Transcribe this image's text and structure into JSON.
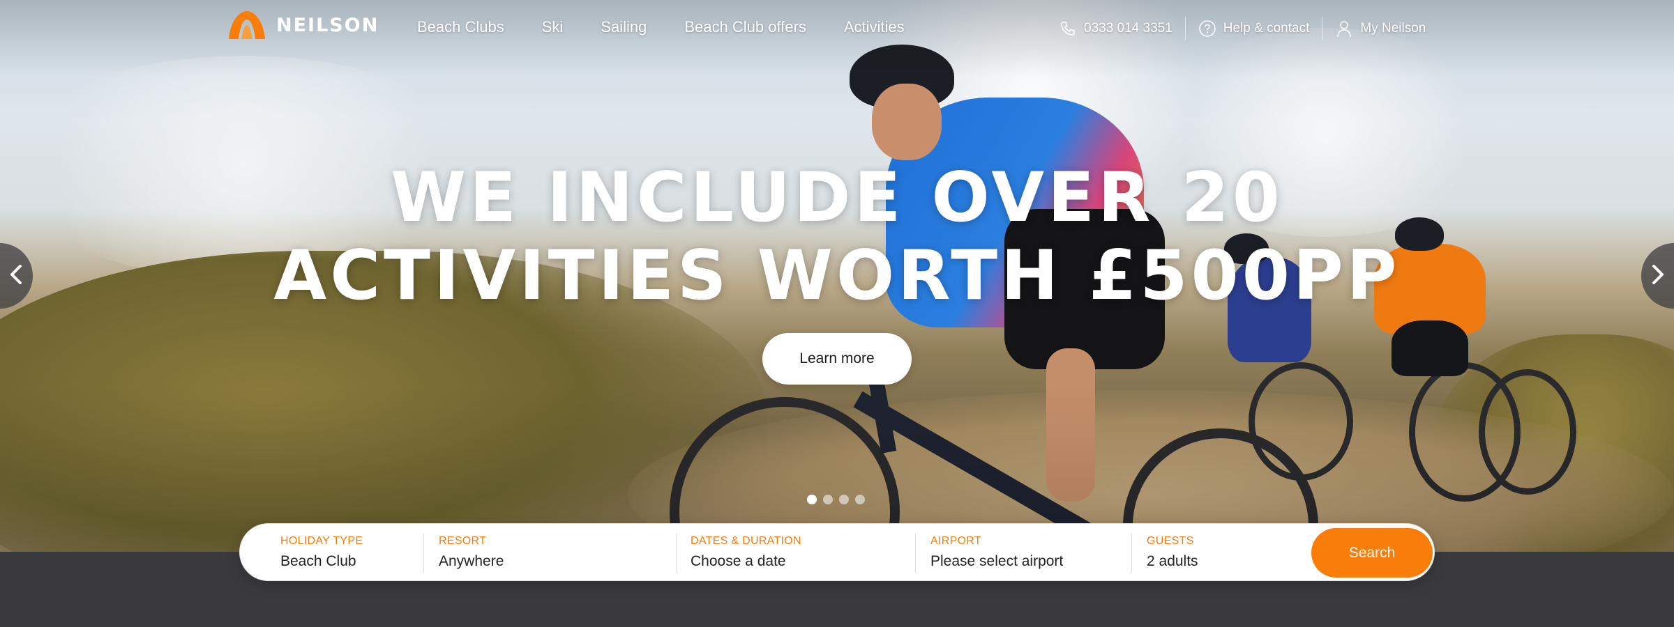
{
  "brand": {
    "name": "NEILSON",
    "accent": "#f97d0a"
  },
  "nav": {
    "menu": [
      {
        "label": "Beach Clubs"
      },
      {
        "label": "Ski"
      },
      {
        "label": "Sailing"
      },
      {
        "label": "Beach Club offers"
      },
      {
        "label": "Activities"
      }
    ],
    "phone": {
      "icon": "phone-icon",
      "label": "0333 014 3351"
    },
    "help": {
      "icon": "help-circle-icon",
      "label": "Help & contact"
    },
    "account": {
      "icon": "user-icon",
      "label": "My Neilson"
    }
  },
  "hero": {
    "headline_line1": "WE INCLUDE OVER 20",
    "headline_line2": "ACTIVITIES WORTH £500PP",
    "cta_label": "Learn more",
    "prev_icon": "chevron-left-icon",
    "next_icon": "chevron-right-icon",
    "slides_total": 4,
    "active_slide": 1
  },
  "search": {
    "fields": [
      {
        "label": "HOLIDAY TYPE",
        "value": "Beach Club"
      },
      {
        "label": "RESORT",
        "value": "Anywhere"
      },
      {
        "label": "DATES & DURATION",
        "value": "Choose a date"
      },
      {
        "label": "AIRPORT",
        "value": "Please select airport"
      },
      {
        "label": "GUESTS",
        "value": "2 adults"
      }
    ],
    "button_label": "Search"
  }
}
